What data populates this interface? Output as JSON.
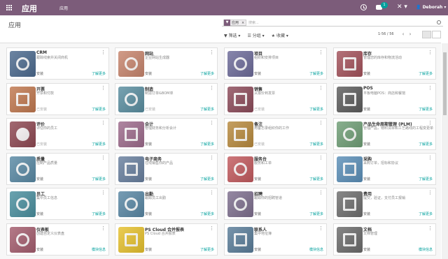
{
  "topbar": {
    "brand": "应用",
    "menu_label": "应用",
    "notification_count": "1",
    "tools_glyph": "✕ ▾",
    "user_name": "Deborah",
    "user_caret": "▾",
    "colors": {
      "bar": "#7c5c7a",
      "accent": "#00a09d"
    }
  },
  "page": {
    "title": "应用"
  },
  "search": {
    "facet_label": "应用",
    "facet_close": "×",
    "placeholder": "搜索..."
  },
  "toolbar": {
    "filter_label": "▼ 筛选 ▾",
    "group_label": "☰ 分组 ▾",
    "favorite_label": "★ 收藏 ▾",
    "pager_text": "1-56 / 56",
    "prev": "‹",
    "next": "›"
  },
  "apps": [
    {
      "name": "CRM",
      "desc": "跟踪线索并关闭商机",
      "status": "安装",
      "action": "了解更多",
      "color": "#4c6a8e",
      "icon": "handshake-icon",
      "installed": false
    },
    {
      "name": "网站",
      "desc": "企业网站生成器",
      "status": "安装",
      "action": "了解更多",
      "color": "#c7856d",
      "icon": "globe-icon",
      "installed": false
    },
    {
      "name": "项目",
      "desc": "组织和安排项目",
      "status": "安装",
      "action": "了解更多",
      "color": "#6d6b99",
      "icon": "puzzle-icon",
      "installed": false
    },
    {
      "name": "库存",
      "desc": "管理您的库存和物流活动",
      "status": "安装",
      "action": "了解更多",
      "color": "#a3525b",
      "icon": "box-icon",
      "installed": false
    },
    {
      "name": "开票",
      "desc": "开票和付款",
      "status": "已安装",
      "action": "了解更多",
      "color": "#c0784f",
      "icon": "invoice-icon",
      "installed": true
    },
    {
      "name": "制造",
      "desc": "制造订单&BOM单",
      "status": "已安装",
      "action": "了解更多",
      "color": "#5a8ea0",
      "icon": "wrench-icon",
      "installed": true
    },
    {
      "name": "销售",
      "desc": "从报价到发票",
      "status": "已安装",
      "action": "了解更多",
      "color": "#8c4b5a",
      "icon": "sales-chart-icon",
      "installed": true
    },
    {
      "name": "POS",
      "desc": "平板电脑POS：商店和餐馆",
      "status": "安装",
      "action": "了解更多",
      "color": "#5c5c5c",
      "icon": "shop-icon",
      "installed": false
    },
    {
      "name": "评价",
      "desc": "评估你的员工",
      "status": "已安装",
      "action": "了解更多",
      "color": "#8e4852",
      "icon": "star-icon",
      "installed": true
    },
    {
      "name": "会计",
      "desc": "管理财务和分析会计",
      "status": "安装",
      "action": "了解更多",
      "color": "#9d6b8c",
      "icon": "ledger-icon",
      "installed": false
    },
    {
      "name": "备注",
      "desc": "用备忘录组织你的工作",
      "status": "已安装",
      "action": "了解更多",
      "color": "#b88a3e",
      "icon": "notes-icon",
      "installed": true
    },
    {
      "name": "产品生命周期管理 (PLM)",
      "desc": "管理产品，物料清单和工艺路线的工程变更单",
      "status": "安装",
      "action": "了解更多",
      "color": "#6f9e76",
      "icon": "cycle-icon",
      "installed": false
    },
    {
      "name": "质量",
      "desc": "控制产品质量",
      "status": "安装",
      "action": "了解更多",
      "color": "#5989a4",
      "icon": "quality-icon",
      "installed": false
    },
    {
      "name": "电子商务",
      "desc": "在线销售你的产品",
      "status": "安装",
      "action": "了解更多",
      "color": "#687f9e",
      "icon": "cart-icon",
      "installed": false
    },
    {
      "name": "服务台",
      "desc": "服务和工单",
      "status": "安装",
      "action": "了解更多",
      "color": "#c25a5e",
      "icon": "lifebuoy-icon",
      "installed": false
    },
    {
      "name": "采购",
      "desc": "采购订单，招标和协议",
      "status": "安装",
      "action": "了解更多",
      "color": "#5b8fb8",
      "icon": "credit-card-icon",
      "installed": false
    },
    {
      "name": "员工",
      "desc": "集中员工信息",
      "status": "安装",
      "action": "了解更多",
      "color": "#4a8f9e",
      "icon": "people-icon",
      "installed": false
    },
    {
      "name": "出勤",
      "desc": "跟踪员工出勤",
      "status": "安装",
      "action": "了解更多",
      "color": "#5987a4",
      "icon": "attendance-icon",
      "installed": false
    },
    {
      "name": "招聘",
      "desc": "跟踪你的招聘管道",
      "status": "安装",
      "action": "了解更多",
      "color": "#7e6f8e",
      "icon": "magnifier-icon",
      "installed": false
    },
    {
      "name": "费用",
      "desc": "提交，验证，支付员工报销",
      "status": "安装",
      "action": "了解更多",
      "color": "#6e6e6e",
      "icon": "expense-icon",
      "installed": false
    },
    {
      "name": "仪表板",
      "desc": "创建自定义仪表盘",
      "status": "安装",
      "action": "模块信息",
      "color": "#a45d6e",
      "icon": "dashboard-icon",
      "installed": false
    },
    {
      "name": "PS Cloud 合并报表",
      "desc": "PS Cloud 合并报表",
      "status": "安装",
      "action": "了解更多",
      "color": "#e6c12e",
      "icon": "report-icon",
      "installed": false
    },
    {
      "name": "联系人",
      "desc": "集中地址簿",
      "status": "安装",
      "action": "模块信息",
      "color": "#5a7d99",
      "icon": "contacts-icon",
      "installed": false
    },
    {
      "name": "文档",
      "desc": "文档管理",
      "status": "安装",
      "action": "模块信息",
      "color": "#6b6b6b",
      "icon": "documents-icon",
      "installed": false
    }
  ]
}
